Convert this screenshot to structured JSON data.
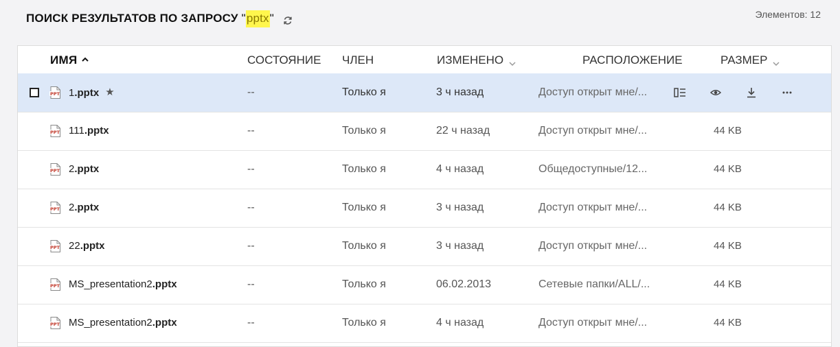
{
  "header": {
    "title_prefix": "ПОИСК РЕЗУЛЬТАТОВ ПО ЗАПРОСУ ",
    "quote_open": "\"",
    "query": "pptx",
    "quote_close": "\"",
    "count_text": "Элементов: 12"
  },
  "columns": {
    "name": "ИМЯ",
    "status": "СОСТОЯНИЕ",
    "member": "ЧЛЕН",
    "modified": "ИЗМЕНЕНО",
    "location": "РАСПОЛОЖЕНИЕ",
    "size": "РАЗМЕР"
  },
  "rows": [
    {
      "name": "1",
      "ext": ".pptx",
      "status": "--",
      "member": "Только я",
      "modified": "3 ч назад",
      "location": "Доступ открыт мне/...",
      "size": ""
    },
    {
      "name": "111",
      "ext": ".pptx",
      "status": "--",
      "member": "Только я",
      "modified": "22 ч назад",
      "location": "Доступ открыт мне/...",
      "size": "44 KB"
    },
    {
      "name": "2",
      "ext": ".pptx",
      "status": "--",
      "member": "Только я",
      "modified": "4 ч назад",
      "location": "Общедоступные/12...",
      "size": "44 KB"
    },
    {
      "name": "2",
      "ext": ".pptx",
      "status": "--",
      "member": "Только я",
      "modified": "3 ч назад",
      "location": "Доступ открыт мне/...",
      "size": "44 KB"
    },
    {
      "name": "22",
      "ext": ".pptx",
      "status": "--",
      "member": "Только я",
      "modified": "3 ч назад",
      "location": "Доступ открыт мне/...",
      "size": "44 KB"
    },
    {
      "name": "MS_presentation2",
      "ext": ".pptx",
      "status": "--",
      "member": "Только я",
      "modified": "06.02.2013",
      "location": "Сетевые папки/ALL/...",
      "size": "44 KB"
    },
    {
      "name": "MS_presentation2",
      "ext": ".pptx",
      "status": "--",
      "member": "Только я",
      "modified": "4 ч назад",
      "location": "Доступ открыт мне/...",
      "size": "44 KB"
    }
  ],
  "file_icon_label": "PPT",
  "icons": {
    "refresh": "refresh-icon",
    "sort_asc": "sort-ascending-icon",
    "chevron": "chevron-down-icon",
    "star": "star-icon",
    "details": "details-icon",
    "view": "eye-icon",
    "download": "download-icon",
    "more": "more-icon",
    "file": "ppt-file-icon"
  },
  "colors": {
    "selected_row": "#dde8f8",
    "highlight": "#fff64d",
    "file_icon": "#c0392b"
  }
}
